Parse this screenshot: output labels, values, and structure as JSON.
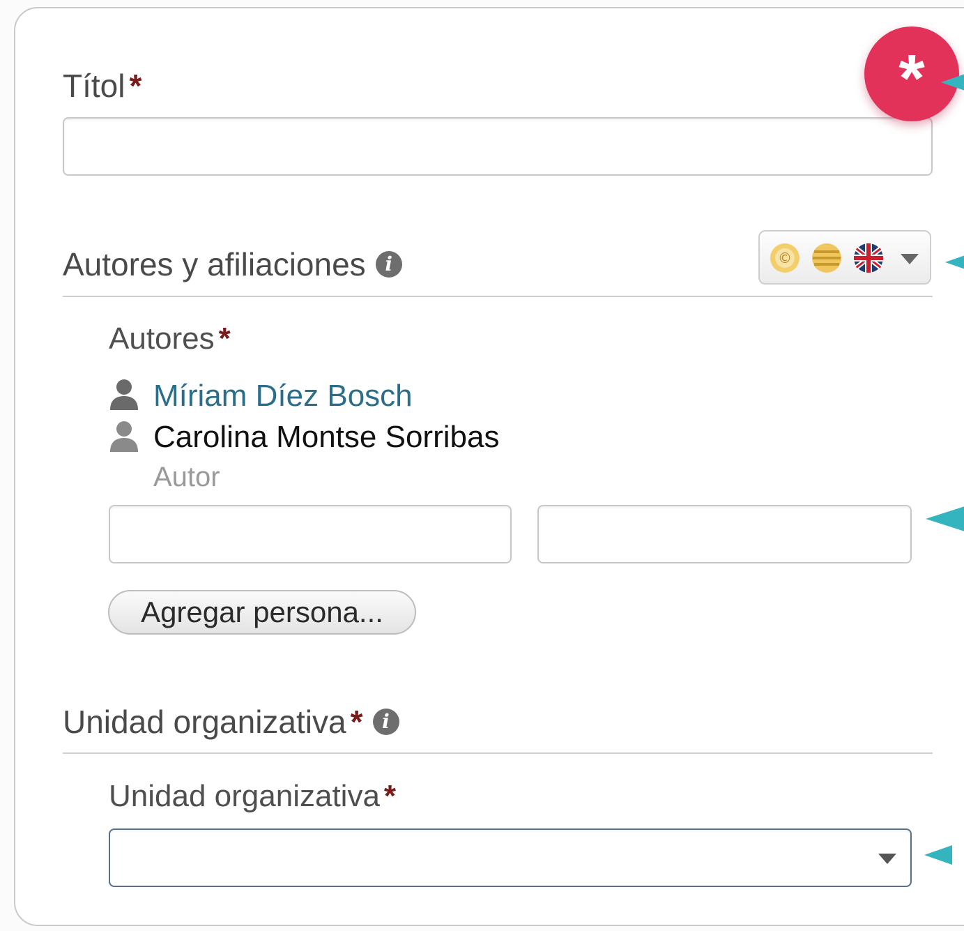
{
  "form": {
    "title_field": {
      "label": "Títol",
      "required_mark": "*",
      "value": ""
    },
    "required_badge": "*",
    "authors_section": {
      "heading": "Autores y afiliaciones",
      "info_icon": "info-icon",
      "language_selector": {
        "options": [
          "catalan-flag",
          "spanish-flag",
          "uk-flag"
        ]
      },
      "authors_label": "Autores",
      "required_mark": "*",
      "authors": [
        {
          "name": "Míriam Díez Bosch",
          "color": "#2b6e8a",
          "icon": "person-icon"
        },
        {
          "name": "Carolina Montse Sorribas",
          "color": "#111111",
          "icon": "person-icon"
        }
      ],
      "role_label": "Autor",
      "first_name_value": "",
      "last_name_value": "",
      "add_person_button": "Agregar persona..."
    },
    "org_section": {
      "heading": "Unidad organizativa",
      "required_mark": "*",
      "info_icon": "info-icon",
      "field_label": "Unidad organizativa",
      "field_required_mark": "*",
      "selected_value": ""
    }
  },
  "colors": {
    "required": "#7a1b1b",
    "badge": "#e3325a",
    "arrow": "#33b4bf",
    "link": "#2b6e8a"
  }
}
